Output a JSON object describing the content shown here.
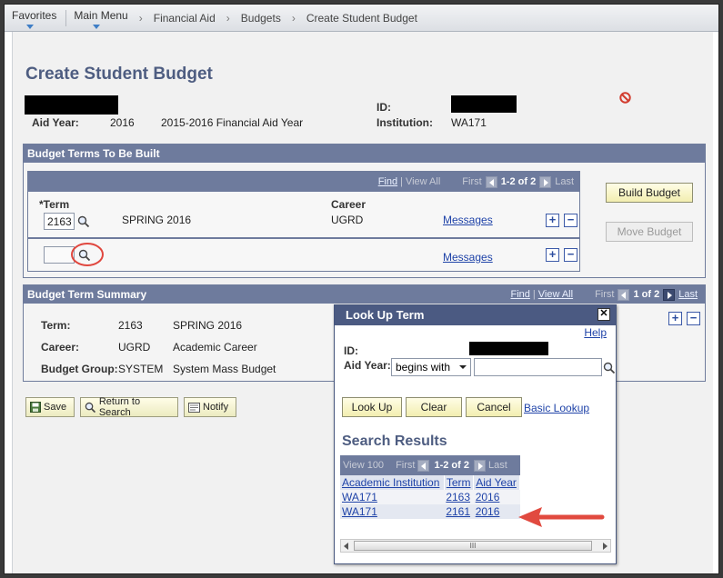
{
  "navbar": {
    "favorites": "Favorites",
    "main_menu": "Main Menu",
    "breadcrumbs": [
      "Financial Aid",
      "Budgets",
      "Create Student Budget"
    ],
    "separator": "›"
  },
  "page": {
    "title": "Create Student Budget",
    "id_label": "ID:",
    "aid_year_label": "Aid Year:",
    "aid_year_value": "2016",
    "aid_year_desc": "2015-2016 Financial Aid Year",
    "institution_label": "Institution:",
    "institution_value": "WA171"
  },
  "budget_terms": {
    "header": "Budget Terms To Be Built",
    "nav": {
      "find": "Find",
      "view_all": "View All",
      "first": "First",
      "range": "1-2 of 2",
      "last": "Last"
    },
    "term_label": "*Term",
    "career_label": "Career",
    "rows": [
      {
        "term": "2163",
        "desc": "SPRING 2016",
        "career": "UGRD",
        "messages": "Messages"
      },
      {
        "term": "",
        "desc": "",
        "career": "",
        "messages": "Messages"
      }
    ],
    "build_button": "Build Budget",
    "move_button": "Move Budget"
  },
  "summary": {
    "header": "Budget Term Summary",
    "nav": {
      "find": "Find",
      "view_all": "View All",
      "first": "First",
      "range": "1 of 2",
      "last": "Last"
    },
    "term_label": "Term:",
    "term_value": "2163",
    "term_desc": "SPRING 2016",
    "career_label": "Career:",
    "career_value": "UGRD",
    "career_desc": "Academic Career",
    "group_label": "Budget Group:",
    "group_value": "SYSTEM",
    "group_desc": "System Mass Budget"
  },
  "toolbar": {
    "save": "Save",
    "return": "Return to Search",
    "notify": "Notify"
  },
  "lookup": {
    "title": "Look Up Term",
    "close": "✕",
    "help": "Help",
    "id_label": "ID:",
    "aid_year_label": "Aid Year:",
    "operator": "begins with",
    "aid_year_value": "",
    "lookup_button": "Look Up",
    "clear_button": "Clear",
    "cancel_button": "Cancel",
    "basic_lookup": "Basic Lookup",
    "results_title": "Search Results",
    "results_nav": {
      "view": "View 100",
      "first": "First",
      "range": "1-2 of 2",
      "last": "Last"
    },
    "columns": [
      "Academic Institution",
      "Term",
      "Aid Year"
    ],
    "rows": [
      [
        "WA171",
        "2163",
        "2016"
      ],
      [
        "WA171",
        "2161",
        "2016"
      ]
    ],
    "scroll_grip": "III"
  },
  "colors": {
    "accent": "#4e5d81",
    "header_bar": "#6e7b9d",
    "highlight_circle": "#e0473e",
    "arrow": "#e14a3f"
  }
}
